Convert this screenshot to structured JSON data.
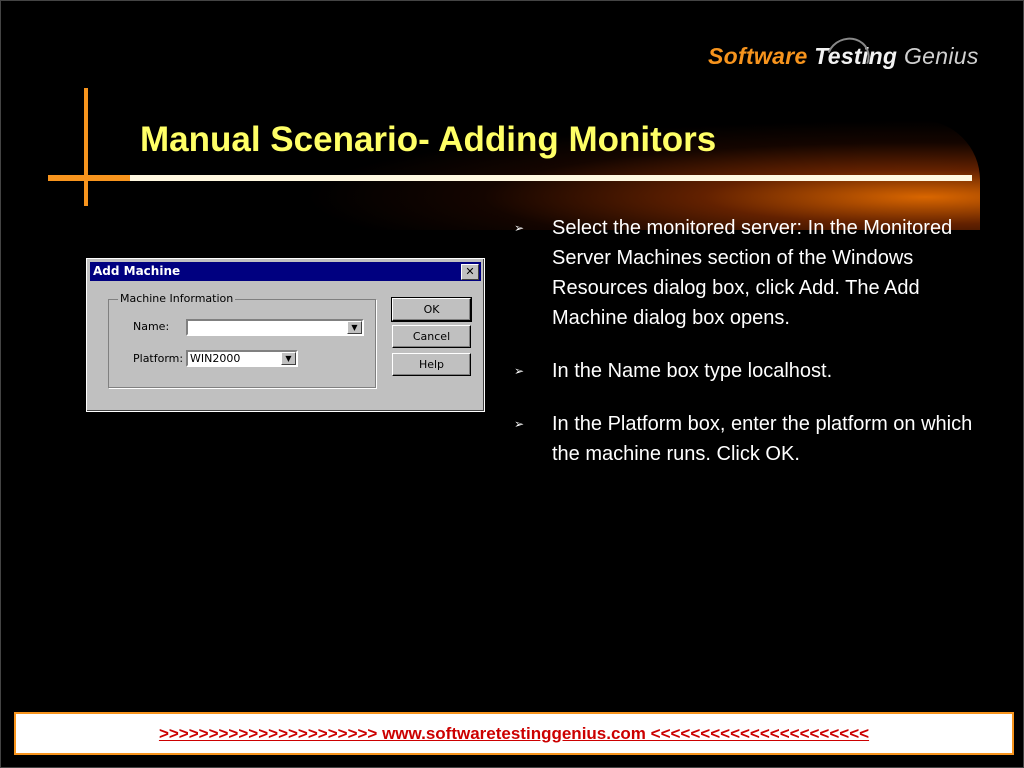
{
  "brand": {
    "word1": "Software",
    "word2": "Testing",
    "word3": "Genius"
  },
  "slide": {
    "title": "Manual Scenario- Adding Monitors"
  },
  "dialog": {
    "title": "Add Machine",
    "close_glyph": "✕",
    "group_label": "Machine Information",
    "name_label": "Name:",
    "name_value": "",
    "platform_label": "Platform:",
    "platform_value": "WIN2000",
    "ok_label": "OK",
    "cancel_label": "Cancel",
    "help_label": "Help"
  },
  "bullets": [
    "Select the monitored server: In the Monitored Server Machines section of the Windows Resources dialog box, click Add. The Add Machine dialog box opens.",
    "In the Name box type localhost.",
    "In the Platform box, enter the platform on which the machine runs. Click OK."
  ],
  "footer": {
    "text": ">>>>>>>>>>>>>>>>>>>>>>  www.softwaretestinggenius.com  <<<<<<<<<<<<<<<<<<<<<<"
  },
  "colors": {
    "accent": "#f7941d",
    "title": "#ffff66",
    "footer_text": "#cc0000",
    "dialog_titlebar": "#000080"
  }
}
